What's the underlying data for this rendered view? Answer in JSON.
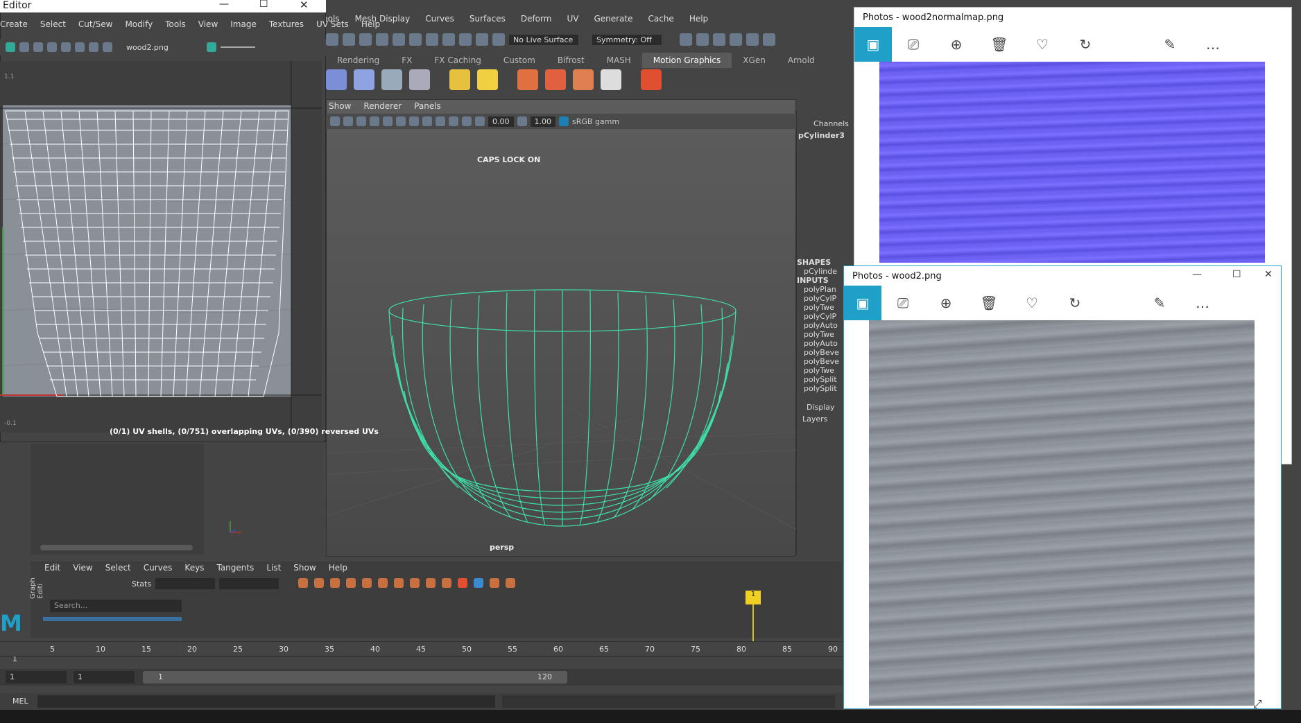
{
  "colors": {
    "wire_green": "#3ee0a8",
    "photo_accent": "#1ea0c8",
    "normal_map": "#6a5ef0",
    "wood": "#8a9098"
  },
  "maya": {
    "menu": [
      "Tools",
      "Mesh Display",
      "Curves",
      "Surfaces",
      "Deform",
      "UV",
      "Generate",
      "Cache",
      "Help"
    ],
    "live_surface": "No Live Surface",
    "symmetry": "Symmetry: Off",
    "shelf_tabs": [
      "Rendering",
      "FX",
      "FX Caching",
      "Custom",
      "Bifrost",
      "MASH",
      "Motion Graphics",
      "XGen",
      "Arnold"
    ],
    "active_shelf": "Motion Graphics",
    "viewport_menu": [
      "Show",
      "Renderer",
      "Panels"
    ],
    "exposure": "0.00",
    "gamma": "1.00",
    "color_space": "sRGB gamm",
    "caps_lock": "CAPS LOCK ON",
    "camera": "persp",
    "channel_box": {
      "title": "Channels",
      "object": "pCylinder3",
      "shapes_label": "SHAPES",
      "shape_item": "pCylinde",
      "inputs_label": "INPUTS",
      "inputs": [
        "polyPlan",
        "polyCylP",
        "polyTwe",
        "polyCylP",
        "polyAuto",
        "polyTwe",
        "polyAuto",
        "polyBeve",
        "polyBeve",
        "polyTwe",
        "polySplit",
        "polySplit"
      ],
      "display": "Display",
      "layers": "Layers"
    },
    "graph_editor": {
      "menu": [
        "Edit",
        "View",
        "Select",
        "Curves",
        "Keys",
        "Tangents",
        "List",
        "Show",
        "Help"
      ],
      "stats_label": "Stats",
      "search_placeholder": "Search...",
      "side_label": "Graph Editi"
    },
    "timeline": {
      "ticks": [
        "1",
        "5",
        "10",
        "15",
        "20",
        "25",
        "30",
        "35",
        "40",
        "45",
        "50",
        "55",
        "60",
        "65",
        "70",
        "75",
        "80",
        "85",
        "90"
      ],
      "current_frame": "1"
    },
    "range": {
      "start": "1",
      "anim_start": "1",
      "inner_start": "1",
      "end": "120"
    },
    "mel_label": "MEL"
  },
  "uv_editor": {
    "title": "Editor",
    "menu": [
      "Create",
      "Select",
      "Cut/Sew",
      "Modify",
      "Tools",
      "View",
      "Image",
      "Textures",
      "UV Sets",
      "Help"
    ],
    "texture_name": "wood2.png",
    "axis_top": "1.1",
    "axis_bottom": "-0.1",
    "status": "(0/1) UV shells, (0/751) overlapping UVs, (0/390) reversed UVs"
  },
  "photos_normal": {
    "title": "Photos - wood2normalmap.png"
  },
  "photos_wood": {
    "title": "Photos - wood2.png"
  }
}
